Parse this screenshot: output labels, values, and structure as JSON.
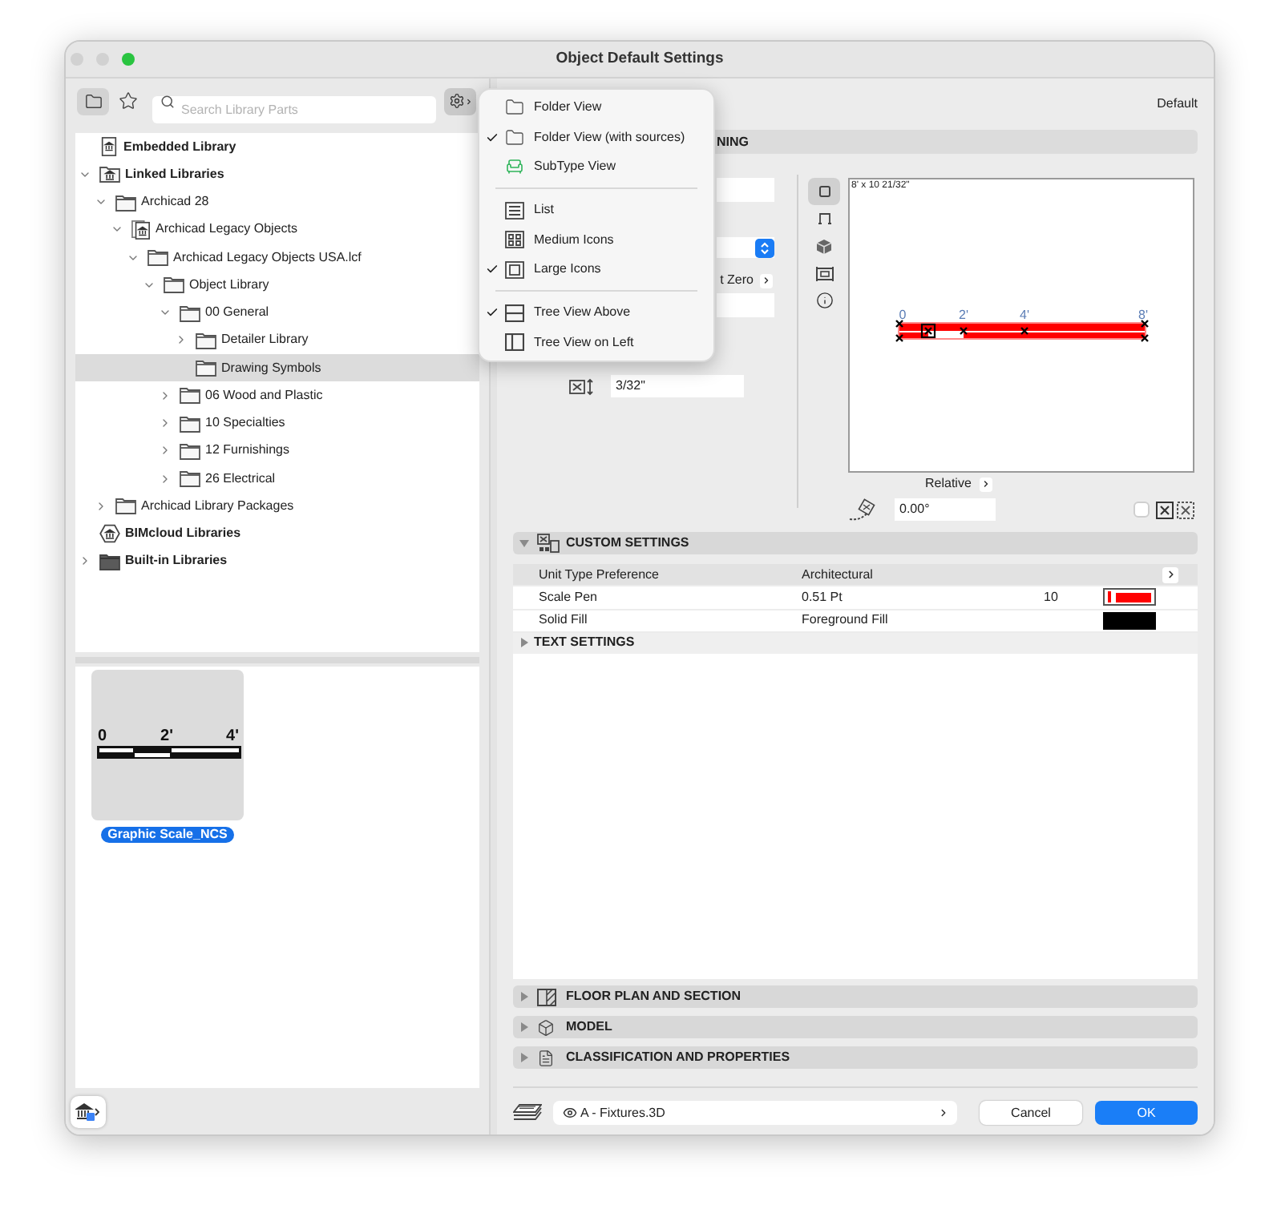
{
  "window": {
    "title": "Object Default Settings"
  },
  "library": {
    "view_buttons": [
      {
        "kind": "folder",
        "selected": true
      },
      {
        "kind": "favorites",
        "selected": false
      }
    ],
    "search": {
      "placeholder": "Search Library Parts"
    },
    "tree": [
      {
        "label": "Embedded Library",
        "kind": "embedded",
        "selected": false
      },
      {
        "label": "Linked Libraries",
        "kind": "linked",
        "expanded": true,
        "selected": false,
        "children": [
          {
            "label": "Archicad 28",
            "kind": "folder",
            "expanded": true,
            "selected": false,
            "children": [
              {
                "label": "Archicad Legacy Objects",
                "kind": "legacy",
                "expanded": true,
                "selected": false,
                "children": [
                  {
                    "label": "Archicad Legacy Objects USA.lcf",
                    "kind": "folder",
                    "expanded": true,
                    "selected": false,
                    "children": [
                      {
                        "label": "Object Library",
                        "kind": "folder",
                        "expanded": true,
                        "selected": false,
                        "children": [
                          {
                            "label": "00 General",
                            "kind": "folder",
                            "expanded": true,
                            "selected": false,
                            "children": [
                              {
                                "label": "Detailer Library",
                                "kind": "folder",
                                "expanded": false,
                                "selected": false
                              },
                              {
                                "label": "Drawing Symbols",
                                "kind": "folder",
                                "selected": true
                              }
                            ]
                          },
                          {
                            "label": "06 Wood and Plastic",
                            "kind": "folder",
                            "expanded": false,
                            "selected": false
                          },
                          {
                            "label": "10 Specialties",
                            "kind": "folder",
                            "expanded": false,
                            "selected": false
                          },
                          {
                            "label": "12 Furnishings",
                            "kind": "folder",
                            "expanded": false,
                            "selected": false
                          },
                          {
                            "label": "26 Electrical",
                            "kind": "folder",
                            "expanded": false,
                            "selected": false
                          }
                        ]
                      }
                    ]
                  }
                ]
              }
            ]
          },
          {
            "label": "Archicad Library Packages",
            "kind": "folder",
            "expanded": false,
            "selected": false
          }
        ]
      },
      {
        "label": "BIMcloud Libraries",
        "kind": "bimcloud",
        "selected": false
      },
      {
        "label": "Built-in Libraries",
        "kind": "builtin",
        "expanded": false,
        "selected": false
      }
    ],
    "results": [
      {
        "name": "Graphic Scale_NCS",
        "selected": true,
        "scale_labels": [
          "0",
          "2'",
          "4'"
        ]
      }
    ]
  },
  "view_menu": {
    "sections": [
      {
        "items": [
          {
            "label": "Folder View",
            "kind": "folder",
            "checked": false
          },
          {
            "label": "Folder View (with sources)",
            "kind": "folder",
            "checked": true
          },
          {
            "label": "SubType View",
            "kind": "subtype",
            "checked": false
          }
        ]
      },
      {
        "items": [
          {
            "label": "List",
            "kind": "list",
            "checked": false
          },
          {
            "label": "Medium Icons",
            "kind": "medium_icons",
            "checked": false
          },
          {
            "label": "Large Icons",
            "kind": "large_icons",
            "checked": true
          }
        ]
      },
      {
        "items": [
          {
            "label": "Tree View Above",
            "kind": "tree_above",
            "checked": true
          },
          {
            "label": "Tree View on Left",
            "kind": "tree_left",
            "checked": false
          }
        ]
      }
    ]
  },
  "settings": {
    "preset": "Default",
    "preview_section": {
      "title": "NING"
    },
    "placement_fields": [
      {
        "kind": "input"
      },
      {
        "kind": "select"
      },
      {
        "kind": "option",
        "label": "t Zero"
      },
      {
        "kind": "input"
      },
      {
        "kind": "height",
        "value": "3/32\""
      }
    ],
    "preview": {
      "view_buttons": [
        {
          "kind": "symbol",
          "selected": true
        },
        {
          "kind": "front",
          "selected": false
        },
        {
          "kind": "model",
          "selected": false
        },
        {
          "kind": "section",
          "selected": false
        },
        {
          "kind": "info",
          "selected": false
        }
      ],
      "size_label": "8' x 10 21/32\"",
      "scale_labels": [
        "0",
        "2'",
        "4'",
        "8'"
      ],
      "anchor": "Relative",
      "rotation": "0.00°",
      "mirror": {
        "checked": false
      }
    },
    "custom_settings": {
      "title": "CUSTOM SETTINGS",
      "expanded": true,
      "rows": [
        {
          "name": "Unit Type Preference",
          "value": "Architectural",
          "kind": "option",
          "selected": true
        },
        {
          "name": "Scale Pen",
          "value": "0.51 Pt",
          "number": "10",
          "kind": "pen",
          "color": "#ff0000",
          "selected": false
        },
        {
          "name": "Solid Fill",
          "value": "Foreground Fill",
          "kind": "fill",
          "color": "#000000",
          "selected": false
        }
      ]
    },
    "text_settings": {
      "title": "TEXT SETTINGS",
      "expanded": false
    },
    "panels": [
      {
        "title": "FLOOR PLAN AND SECTION",
        "kind": "floor_plan",
        "expanded": false
      },
      {
        "title": "MODEL",
        "kind": "model",
        "expanded": false
      },
      {
        "title": "CLASSIFICATION AND PROPERTIES",
        "kind": "classification",
        "expanded": false
      }
    ]
  },
  "footer": {
    "layer": "A - Fixtures.3D",
    "buttons": [
      {
        "label": "Cancel",
        "kind": "secondary"
      },
      {
        "label": "OK",
        "kind": "primary"
      }
    ]
  }
}
